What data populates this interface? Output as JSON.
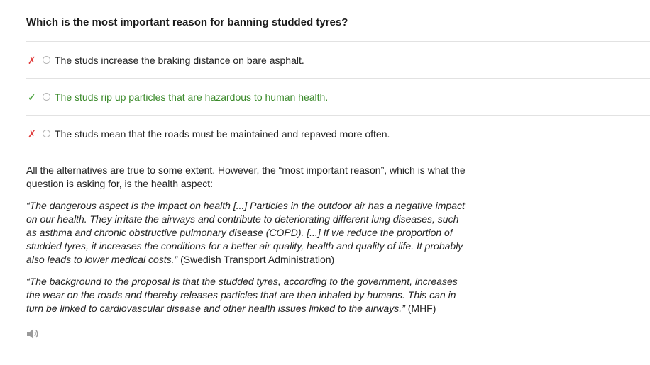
{
  "question": "Which is the most important reason for banning studded tyres?",
  "options": [
    {
      "status": "wrong",
      "mark_icon": "cross-icon",
      "text": "The studs increase the braking distance on bare asphalt."
    },
    {
      "status": "correct",
      "mark_icon": "check-icon",
      "text": "The studs rip up particles that are hazardous to human health."
    },
    {
      "status": "wrong",
      "mark_icon": "cross-icon",
      "text": "The studs mean that the roads must be maintained and repaved more often."
    }
  ],
  "explanation": {
    "intro": "All the alternatives are true to some extent. However, the “most important reason”, which is what the question is asking for, is the health aspect:",
    "quote1": "“The dangerous aspect is the impact on health [...] Particles in the outdoor air has a negative impact on our health. They irritate the airways and contribute to deteriorating different lung diseases, such as asthma and chronic obstructive pulmonary disease (COPD). [...] If we reduce the proportion of studded tyres, it increases the conditions for a better air quality, health and quality of life. It probably also leads to lower medical costs.”",
    "source1": "(Swedish Transport Administration)",
    "quote2": "“The background to the proposal is that the studded tyres, according to the government, increases the wear on the roads and thereby releases particles that are then inhaled by humans. This can in turn be linked to cardiovascular disease and other health issues linked to the airways.”",
    "source2": "(MHF)"
  },
  "colors": {
    "wrong": "#e03c3c",
    "correct": "#3a8a2a"
  },
  "audio": {
    "icon": "speaker-icon"
  }
}
